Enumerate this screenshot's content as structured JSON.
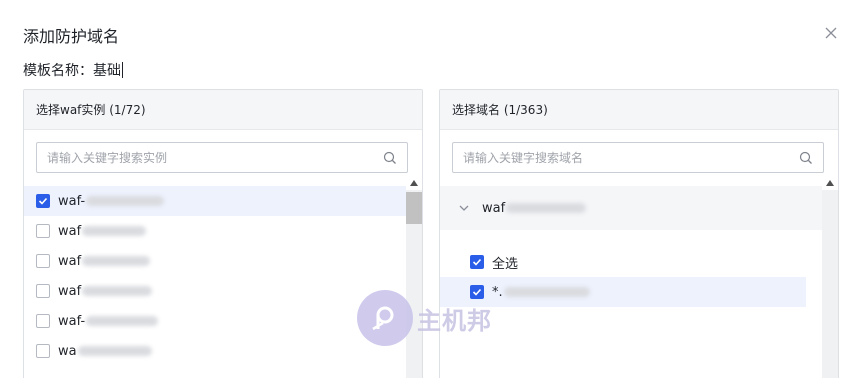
{
  "dialog": {
    "title": "添加防护域名",
    "template_label": "模板名称：",
    "template_value": "基础"
  },
  "left_panel": {
    "header": "选择waf实例 (1/72)",
    "search_placeholder": "请输入关键字搜索实例",
    "items": [
      {
        "prefix": "waf-",
        "checked": true
      },
      {
        "prefix": "waf",
        "checked": false
      },
      {
        "prefix": "waf",
        "checked": false
      },
      {
        "prefix": "waf",
        "checked": false
      },
      {
        "prefix": "waf-",
        "checked": false
      },
      {
        "prefix": "wa",
        "checked": false
      }
    ]
  },
  "right_panel": {
    "header": "选择域名 (1/363)",
    "search_placeholder": "请输入关键字搜索域名",
    "group_label": "waf",
    "select_all_label": "全选",
    "domain_prefix": "*."
  },
  "watermark": {
    "text": "主机邦"
  },
  "colors": {
    "accent": "#2b5ee8",
    "selected_row": "#eef2fd",
    "panel_header": "#f5f6f8"
  }
}
